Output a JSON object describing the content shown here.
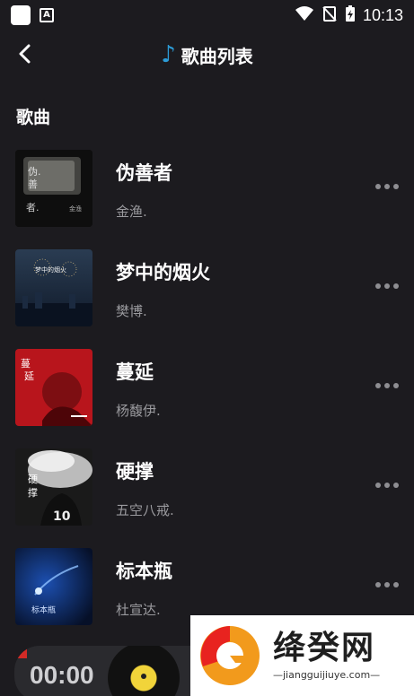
{
  "status_bar": {
    "time": "10:13"
  },
  "header": {
    "title": "歌曲列表",
    "back_icon": "chevron-left-icon",
    "title_icon": "music-note-icon",
    "accent": "#2c9bd6"
  },
  "section": {
    "title": "歌曲"
  },
  "songs": [
    {
      "title": "伪善者",
      "artist": "金渔.",
      "cover_text": "伪.善\n者."
    },
    {
      "title": "梦中的烟火",
      "artist": "樊博.",
      "cover_text": "梦中的烟火"
    },
    {
      "title": "蔓延",
      "artist": "杨馥伊.",
      "cover_text": "蔓\n延"
    },
    {
      "title": "硬撑",
      "artist": "五空八戒.",
      "cover_text": "硬\n撑"
    },
    {
      "title": "标本瓶",
      "artist": "杜宣达.",
      "cover_text": "标本瓶"
    }
  ],
  "player": {
    "time": "00:00"
  },
  "watermark": {
    "brand": "绛癸网",
    "url": "—jiangguijiuye.com—"
  }
}
